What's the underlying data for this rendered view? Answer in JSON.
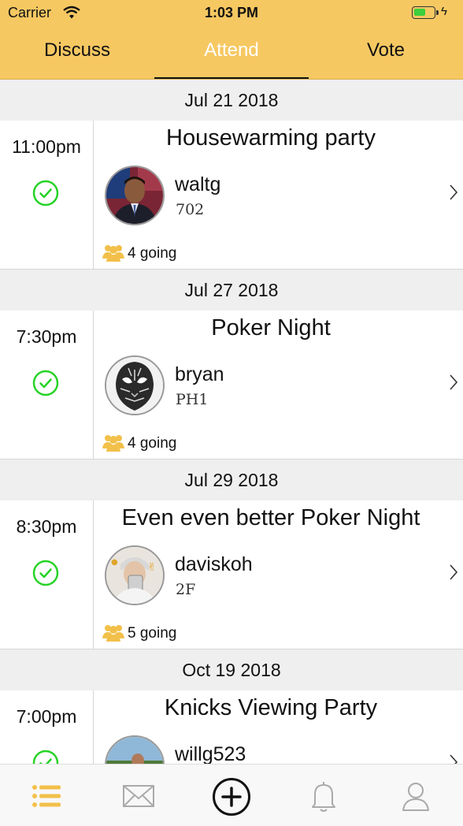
{
  "status_bar": {
    "carrier": "Carrier",
    "time": "1:03 PM"
  },
  "top_tabs": [
    {
      "label": "Discuss",
      "active": false
    },
    {
      "label": "Attend",
      "active": true
    },
    {
      "label": "Vote",
      "active": false
    }
  ],
  "events": [
    {
      "date": "Jul 21 2018",
      "time": "11:00pm",
      "title": "Housewarming party",
      "host": "waltg",
      "unit": "702",
      "going": "4 going",
      "attending": true
    },
    {
      "date": "Jul 27 2018",
      "time": "7:30pm",
      "title": "Poker Night",
      "host": "bryan",
      "unit": "PH1",
      "going": "4 going",
      "attending": true
    },
    {
      "date": "Jul 29 2018",
      "time": "8:30pm",
      "title": "Even even better Poker Night",
      "host": "daviskoh",
      "unit": "2F",
      "going": "5 going",
      "attending": true
    },
    {
      "date": "Oct 19 2018",
      "time": "7:00pm",
      "title": "Knicks Viewing Party",
      "host": "willg523",
      "unit": "",
      "going": "",
      "attending": true
    }
  ],
  "bottom_tabs": [
    {
      "icon": "list-icon",
      "active": true
    },
    {
      "icon": "envelope-icon",
      "active": false
    },
    {
      "icon": "add-circle-icon",
      "active": false
    },
    {
      "icon": "bell-icon",
      "active": false
    },
    {
      "icon": "profile-icon",
      "active": false
    }
  ],
  "colors": {
    "header": "#f6c862",
    "active_icon": "#f2c04a",
    "check": "#27d327",
    "going_icon": "#f2c04a"
  }
}
